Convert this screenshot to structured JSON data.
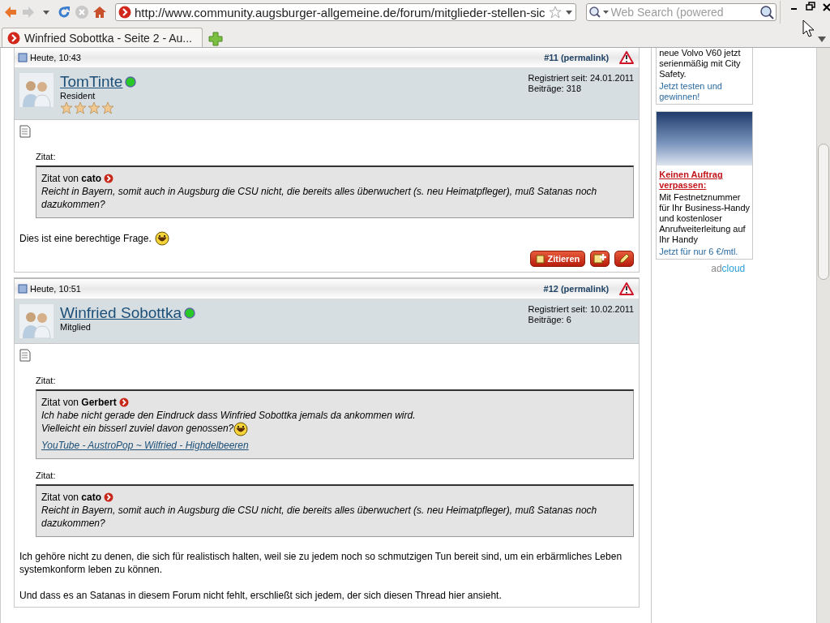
{
  "browser": {
    "url": "http://www.community.augsburger-allgemeine.de/forum/mitglieder-stellen-sic",
    "search_placeholder": "Web Search (powered",
    "tabs": [
      {
        "title": "Winfried Sobottka - Seite 2 - Au...",
        "selected": true
      }
    ]
  },
  "posts": [
    {
      "date": "Heute, 10:43",
      "number": "#11",
      "permalink": "(permalink)",
      "user": {
        "name": "TomTinte",
        "rank": "Resident",
        "online": true,
        "stars": 4
      },
      "registered": "Registriert seit: 24.01.2011",
      "post_count": "Beiträge: 318",
      "quotes": [
        {
          "label": "Zitat:",
          "prefix": "Zitat von",
          "author": "cato",
          "lines": [
            {
              "text": "Reicht in Bayern, somit auch in Augsburg die CSU nicht, die bereits alles überwuchert (s. neu Heimatpfleger), muß Satanas noch dazukommen?",
              "smiley": false
            }
          ]
        }
      ],
      "paragraphs": [
        {
          "text": "Dies ist eine berechtige Frage.",
          "smiley": true
        }
      ],
      "buttons": {
        "quote": "Zitieren"
      }
    },
    {
      "date": "Heute, 10:51",
      "number": "#12",
      "permalink": "(permalink)",
      "user": {
        "name": "Winfried Sobottka",
        "rank": "Mitglied",
        "online": true
      },
      "registered": "Registriert seit: 10.02.2011",
      "post_count": "Beiträge: 6",
      "quotes": [
        {
          "label": "Zitat:",
          "prefix": "Zitat von",
          "author": "Gerbert",
          "lines": [
            {
              "text": "Ich habe nicht gerade den Eindruck dass Winfried Sobottka jemals da ankommen wird.",
              "smiley": false
            },
            {
              "text": "Vielleicht ein bisserl zuviel davon genossen?",
              "smiley": true
            }
          ],
          "link": "YouTube - AustroPop ~ Wilfried - Highdelbeeren"
        },
        {
          "label": "Zitat:",
          "prefix": "Zitat von",
          "author": "cato",
          "lines": [
            {
              "text": "Reicht in Bayern, somit auch in Augsburg die CSU nicht, die bereits alles überwuchert (s. neu Heimatpfleger), muß Satanas noch dazukommen?",
              "smiley": false
            }
          ]
        }
      ],
      "paragraphs": [
        {
          "text": "Ich gehöre nicht zu denen, die sich für realistisch halten, weil sie zu jedem noch so schmutzigen Tun bereit sind, um ein erbärmliches Leben systemkonform leben zu können.",
          "smiley": false
        },
        {
          "text": "Und dass es an Satanas in diesem Forum nicht fehlt, erschließt sich jedem, der sich diesen Thread hier ansieht.",
          "smiley": false
        }
      ]
    }
  ],
  "sidebar": {
    "ads": [
      {
        "kind": "text",
        "body": "neue Volvo V60 jetzt serienmäßig mit City Safety.",
        "cta": "Jetzt testen und gewinnen!"
      },
      {
        "kind": "image",
        "headline": "Keinen Auftrag verpassen:",
        "body": "Mit Festnetznummer für Ihr Business-Handy und kostenloser Anrufweiterleitung auf Ihr Handy",
        "cta": "Jetzt für nur 6 €/mtl."
      }
    ],
    "logo": {
      "left": "ad",
      "right": "cloud"
    }
  }
}
